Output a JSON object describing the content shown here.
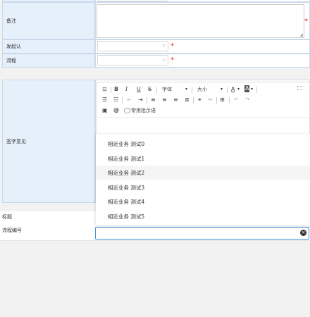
{
  "form": {
    "remark_label": "备注",
    "initiator_label": "发起认",
    "process_label": "流程",
    "sign_label": "签字意见",
    "title_label": "标题",
    "process_no_label": "流程编号",
    "required_mark": "*"
  },
  "editor": {
    "font_select": "字体",
    "size_select": "大小",
    "common_phrases": "常用批示语"
  },
  "dropdown": {
    "items": [
      "相近业务 测试0",
      "相近业务 测试1",
      "相近业务 测试2",
      "相近业务 测试3",
      "相近业务 测试4",
      "相近业务 测试5"
    ],
    "highlighted_index": 2
  },
  "icons": {
    "search": "magnifier-icon",
    "clear": "circle-x-icon",
    "fullscreen": "expand-icon"
  }
}
